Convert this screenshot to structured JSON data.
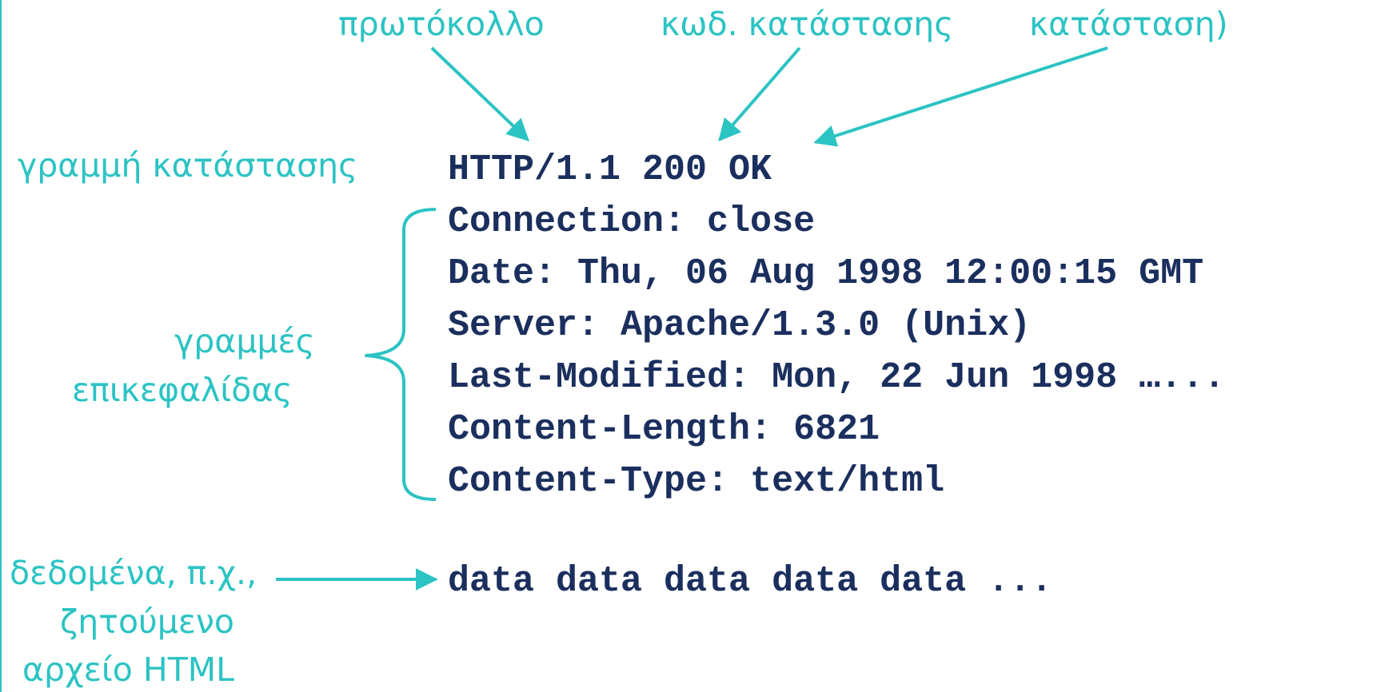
{
  "colors": {
    "annotation": "#2cc3c3",
    "code": "#1b2f5e",
    "background": "#ffffff"
  },
  "annotations": {
    "protocol": "πρωτόκολλο",
    "status_code": "κωδ. κατάστασης",
    "status_phrase": "κατάσταση)",
    "status_line": "γραμμή κατάστασης",
    "header_lines": [
      "γραμμές",
      "επικεφαλίδας"
    ],
    "data": [
      "δεδομένα, π.χ.,",
      "ζητούμενο",
      "αρχείο HTML"
    ]
  },
  "response": {
    "status_line": "HTTP/1.1 200 OK",
    "headers": [
      "Connection: close",
      "Date: Thu, 06 Aug 1998 12:00:15 GMT",
      "Server: Apache/1.3.0 (Unix)",
      "Last-Modified: Mon, 22 Jun 1998 …...",
      "Content-Length: 6821",
      "Content-Type: text/html"
    ],
    "body": "data data data data data ..."
  }
}
